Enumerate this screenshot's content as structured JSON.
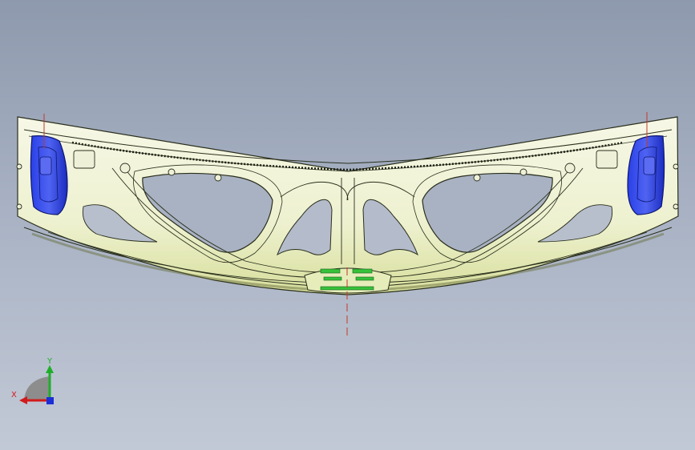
{
  "viewer": {
    "background_top": "#8e99ad",
    "background_bottom": "#c2c9d6",
    "part_fill": "#f3f5d9",
    "part_edge": "#1e2314",
    "part_shade": "#d6dc9a",
    "highlight_blue": "#1f38d8",
    "highlight_green": "#36c23a",
    "centerline_color": "#c0392b"
  },
  "triad": {
    "x_label": "X",
    "y_label": "Y",
    "x_color": "#d11b1b",
    "y_color": "#1fae2a",
    "z_color": "#1c2ed6"
  }
}
